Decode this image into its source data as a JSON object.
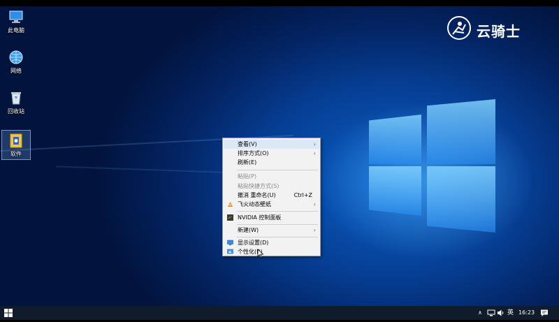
{
  "desktop_icons": [
    {
      "label": "此电脑"
    },
    {
      "label": "网络"
    },
    {
      "label": "回收站"
    },
    {
      "label": "软件"
    }
  ],
  "brand": {
    "text": "云骑士"
  },
  "context_menu": {
    "items": [
      {
        "label": "查看(V)",
        "has_submenu": true,
        "state": "hovered"
      },
      {
        "label": "排序方式(O)",
        "has_submenu": true
      },
      {
        "label": "刷新(E)"
      },
      {
        "label": "粘贴(P)",
        "state": "disabled"
      },
      {
        "label": "粘贴快捷方式(S)",
        "state": "disabled"
      },
      {
        "label": "撤消 重命名(U)",
        "shortcut": "Ctrl+Z"
      },
      {
        "label": "飞火动态壁纸",
        "has_submenu": true,
        "icon": "wallpaper-app-icon"
      },
      {
        "label": "NVIDIA 控制面板",
        "icon": "nvidia-icon"
      },
      {
        "label": "新建(W)",
        "has_submenu": true
      },
      {
        "label": "显示设置(D)",
        "icon": "display-icon"
      },
      {
        "label": "个性化(R)",
        "icon": "personalize-icon"
      }
    ],
    "submenu_arrow": "›"
  },
  "taskbar": {
    "start_icon": "windows-start-icon",
    "tray": {
      "chevron": "∧",
      "ime": "英",
      "time": "16:23",
      "notification_icon": "action-center-icon"
    }
  },
  "colors": {
    "menu_bg": "#f2f2f2",
    "menu_hover": "#dbe8f6",
    "taskbar_bg": "#101c2b",
    "wallpaper_glow": "#5abeff"
  }
}
